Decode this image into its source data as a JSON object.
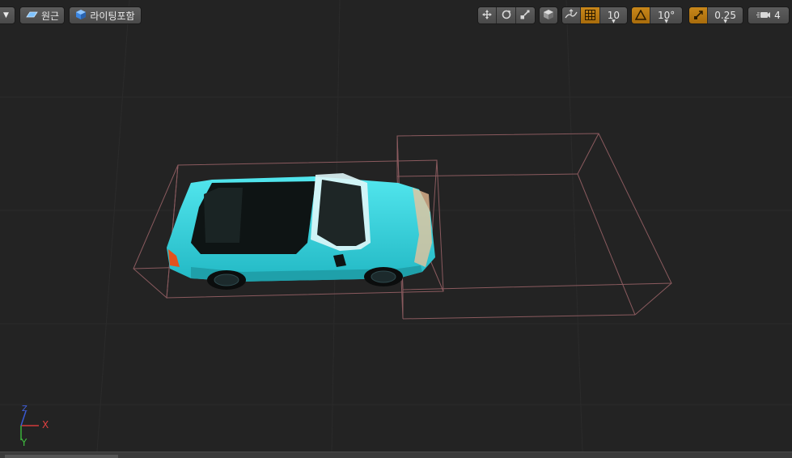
{
  "toolbar": {
    "perspective_label": "원근",
    "lighting_label": "라이팅포함",
    "grid_snap_value": "10",
    "rotation_snap_value": "10°",
    "scale_snap_value": "0.25",
    "camera_speed_value": "4"
  },
  "gizmo": {
    "x_label": "X",
    "y_label": "Y",
    "z_label": "Z"
  },
  "colors": {
    "background": "#232323",
    "accent": "#c8871a",
    "car_body": "#3ed8e0",
    "bounds": "#8a5a5e"
  },
  "icons": [
    "dropdown-arrow-icon",
    "perspective-icon",
    "lighting-cube-icon",
    "translate-icon",
    "rotate-icon",
    "scale-icon",
    "world-local-icon",
    "surface-snap-icon",
    "grid-icon",
    "rotation-snap-icon",
    "scale-snap-icon",
    "camera-speed-icon"
  ]
}
